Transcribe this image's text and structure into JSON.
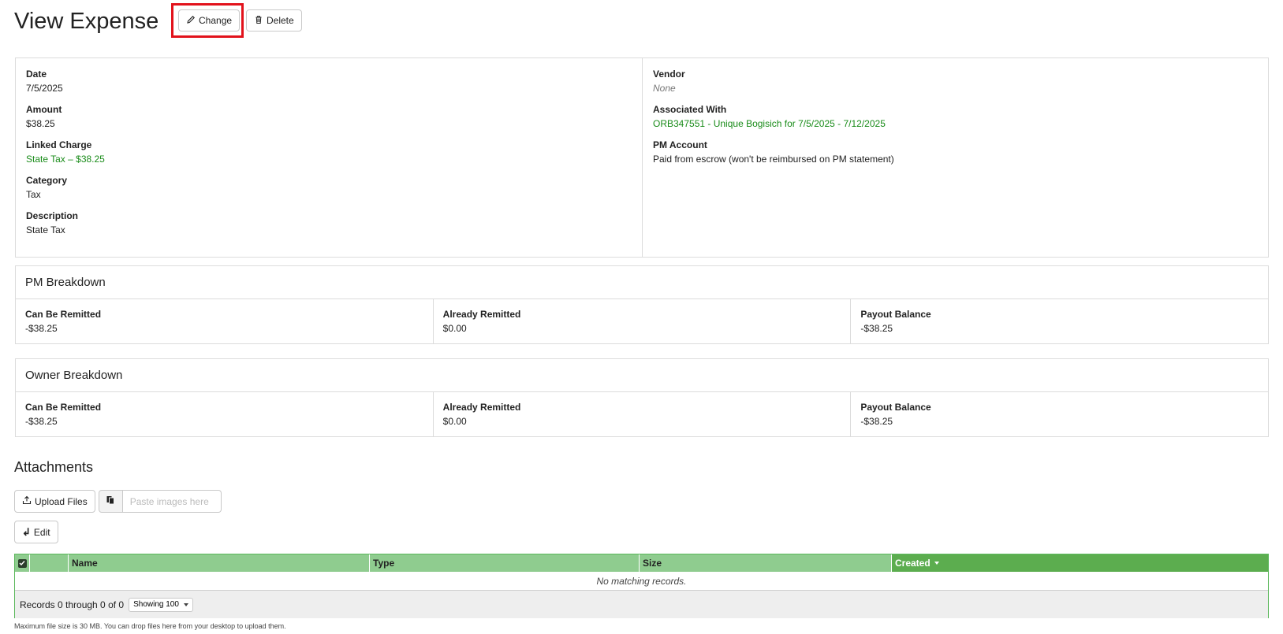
{
  "header": {
    "title": "View Expense",
    "change_label": "Change",
    "delete_label": "Delete"
  },
  "details": {
    "left": [
      {
        "label": "Date",
        "value": "7/5/2025",
        "style": "plain"
      },
      {
        "label": "Amount",
        "value": "$38.25",
        "style": "plain"
      },
      {
        "label": "Linked Charge",
        "value": "State Tax – $38.25",
        "style": "link"
      },
      {
        "label": "Category",
        "value": "Tax",
        "style": "plain"
      },
      {
        "label": "Description",
        "value": "State Tax",
        "style": "plain"
      }
    ],
    "right": [
      {
        "label": "Vendor",
        "value": "None",
        "style": "muted"
      },
      {
        "label": "Associated With",
        "value": "ORB347551 - Unique Bogisich for 7/5/2025 - 7/12/2025",
        "style": "link"
      },
      {
        "label": "PM Account",
        "value": "Paid from escrow (won't be reimbursed on PM statement)",
        "style": "plain"
      }
    ]
  },
  "pm_breakdown": {
    "title": "PM Breakdown",
    "cells": [
      {
        "label": "Can Be Remitted",
        "value": "-$38.25"
      },
      {
        "label": "Already Remitted",
        "value": "$0.00"
      },
      {
        "label": "Payout Balance",
        "value": "-$38.25"
      }
    ]
  },
  "owner_breakdown": {
    "title": "Owner Breakdown",
    "cells": [
      {
        "label": "Can Be Remitted",
        "value": "-$38.25"
      },
      {
        "label": "Already Remitted",
        "value": "$0.00"
      },
      {
        "label": "Payout Balance",
        "value": "-$38.25"
      }
    ]
  },
  "attachments": {
    "title": "Attachments",
    "upload_label": "Upload Files",
    "paste_placeholder": "Paste images here",
    "edit_label": "Edit",
    "table": {
      "columns": [
        "Name",
        "Type",
        "Size",
        "Created"
      ],
      "empty_text": "No matching records.",
      "records_text": "Records 0 through 0 of 0",
      "showing_label": "Showing 100"
    },
    "footnote": "Maximum file size is 30 MB. You can drop files here from your desktop to upload them."
  },
  "colors": {
    "link_green": "#1a8c1a",
    "highlight_red": "#e2121b",
    "table_header": "#8fcc8f",
    "table_header_active": "#5cad4f"
  }
}
